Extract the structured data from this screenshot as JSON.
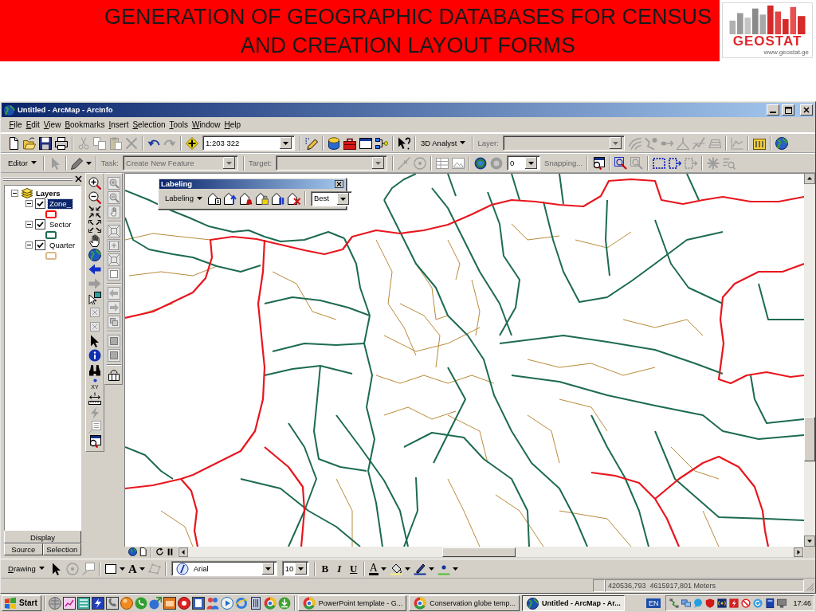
{
  "slide": {
    "title_lines": [
      "GENERATION OF GEOGRAPHIC DATABASES FOR CENSUS",
      "AND CREATION LAYOUT FORMS"
    ],
    "logo": {
      "text": "GEOSTAT",
      "url": "www.geostat.ge"
    }
  },
  "window": {
    "title": "Untitled - ArcMap - ArcInfo"
  },
  "menu": [
    "File",
    "Edit",
    "View",
    "Bookmarks",
    "Insert",
    "Selection",
    "Tools",
    "Window",
    "Help"
  ],
  "standard_toolbar": {
    "scale": "1:203 322"
  },
  "analyst_toolbar": {
    "menu": "3D Analyst",
    "layer_label": "Layer:",
    "disabled": true
  },
  "editor_toolbar": {
    "menu": "Editor",
    "task_label": "Task:",
    "task": "Create New Feature",
    "target_label": "Target:",
    "tolerance": "0",
    "snapping": "Snapping...",
    "disabled": true
  },
  "toc": {
    "root": {
      "label": "Layers",
      "expanded": true,
      "children": [
        {
          "label": "Zone_",
          "checked": true,
          "selected": true,
          "expanded": true,
          "color": "#ff0000"
        },
        {
          "label": "Sector",
          "checked": true,
          "selected": false,
          "expanded": true,
          "color": "#1d6b4f"
        },
        {
          "label": "Quarter",
          "checked": true,
          "selected": false,
          "expanded": true,
          "color": "#d9b98a"
        }
      ]
    },
    "tabs": [
      {
        "label": "Display",
        "selected": true
      },
      {
        "label": "Source",
        "selected": false
      },
      {
        "label": "Selection",
        "selected": false
      }
    ]
  },
  "tools": {
    "go_to_xy": "XY"
  },
  "labeling_toolbar": {
    "title": "Labeling",
    "menu": "Labeling",
    "placement": "Best"
  },
  "drawing_toolbar": {
    "menu": "Drawing",
    "text_tool": "A",
    "font": "Arial",
    "size": "10",
    "styles": [
      {
        "label": "B",
        "kind": "bold"
      },
      {
        "label": "I",
        "kind": "italic"
      },
      {
        "label": "U",
        "kind": "underline"
      }
    ],
    "font_color": "A"
  },
  "status_bar": {
    "coordinates": "420536,793  4615917,801 Meters"
  },
  "taskbar": {
    "start": "Start",
    "tasks": [
      {
        "label": "PowerPoint template - G...",
        "selected": false
      },
      {
        "label": "Conservation globe temp...",
        "selected": false
      },
      {
        "label": "Untitled - ArcMap - Ar...",
        "selected": true
      }
    ],
    "language": "EN",
    "clock": "17:46"
  }
}
